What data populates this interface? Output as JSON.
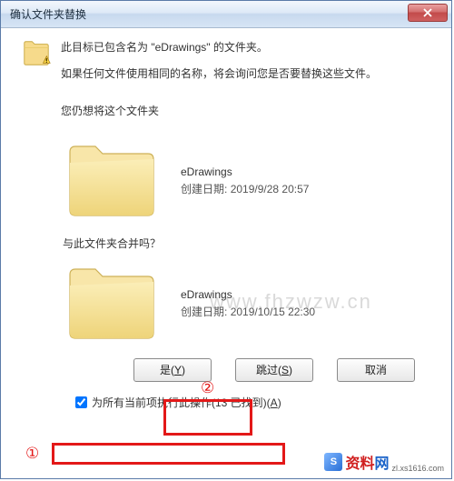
{
  "title": "确认文件夹替换",
  "close_icon_name": "close-icon",
  "msg1_pre": "此目标已包含名为",
  "msg1_quoted": "\"eDrawings\"",
  "msg1_post": "的文件夹。",
  "msg2": "如果任何文件使用相同的名称，将会询问您是否要替换这些文件。",
  "msg3": "您仍想将这个文件夹",
  "source_folder": {
    "name": "eDrawings",
    "date_label": "创建日期:",
    "date_value": "2019/9/28 20:57"
  },
  "merge_prompt": "与此文件夹合并吗？",
  "dest_folder": {
    "name": "eDrawings",
    "date_label": "创建日期:",
    "date_value": "2019/10/15 22:30"
  },
  "buttons": {
    "yes_text": "是(",
    "yes_u": "Y",
    "yes_end": ")",
    "skip_text": "跳过(",
    "skip_u": "S",
    "skip_end": ")",
    "cancel": "取消"
  },
  "checkbox": {
    "pre": "为所有当前项执行此操作(13 已找到)(",
    "u": "A",
    "post": ")"
  },
  "annotations": {
    "num1": "①",
    "num2": "②"
  },
  "watermarks": {
    "w1": "www.fhzwzw.cn",
    "brand_a": "资料",
    "brand_b": "网",
    "brand_url": "zl.xs1616.com"
  }
}
